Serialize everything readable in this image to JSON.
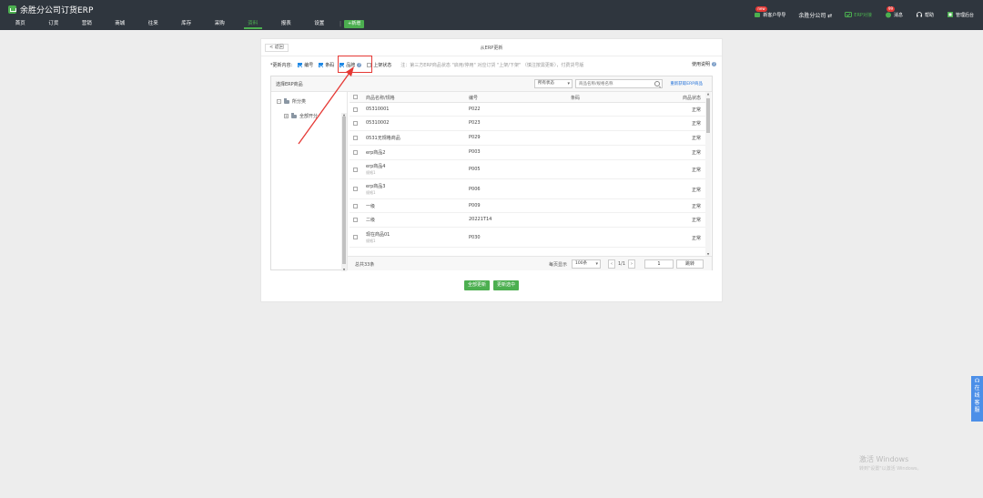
{
  "app": {
    "title": "余胜分公司订货ERP"
  },
  "nav": {
    "items": [
      "首页",
      "订货",
      "营销",
      "商城",
      "往来",
      "库存",
      "采购",
      "资料",
      "报表",
      "设置"
    ],
    "active_index": 7,
    "separator": "|",
    "new_label": "+新增"
  },
  "top_right": {
    "new_guide": {
      "badge": "new",
      "label": "新客户导导"
    },
    "company": "余胜分公司 ⇄",
    "erp_link": "ERP对接",
    "messages": {
      "badge": "99",
      "label": "消息"
    },
    "help": "帮助",
    "admin": "管理后台"
  },
  "card": {
    "back": "< 返回",
    "title": "从ERP更新",
    "options": {
      "label": "*更新内容:",
      "items": [
        {
          "label": "编号",
          "checked": true
        },
        {
          "label": "条码",
          "checked": true
        },
        {
          "label": "品牌",
          "checked": true
        },
        {
          "label": "上架状态",
          "checked": false
        }
      ],
      "note": "注：第三方ERP商品状态 \"启用/停用\" 对应订货 \"上架/下架\" （慎注按需更新），付费货号版"
    },
    "help_link": "使用说明",
    "panel": {
      "title": "选择ERP商品",
      "status_select": "所有状态",
      "search_placeholder": "商品名称/规格名称",
      "refetch_link": "重新获取ERP商品",
      "tree": [
        {
          "label": "所分类",
          "toggle": "-"
        },
        {
          "label": "全部开分",
          "toggle": "+"
        }
      ],
      "columns": {
        "name": "商品名称/规格",
        "code": "编号",
        "barcode": "条码",
        "status": "商品状态"
      },
      "rows": [
        {
          "name": "05310001",
          "sub": "",
          "code": "P022",
          "barcode": "",
          "status": "正常"
        },
        {
          "name": "05310002",
          "sub": "",
          "code": "P023",
          "barcode": "",
          "status": "正常"
        },
        {
          "name": "0531无规格商品",
          "sub": "",
          "code": "P029",
          "barcode": "",
          "status": "正常"
        },
        {
          "name": "erp商品2",
          "sub": "",
          "code": "P003",
          "barcode": "",
          "status": "正常"
        },
        {
          "name": "erp商品4",
          "sub": "规格1",
          "code": "P005",
          "barcode": "",
          "status": "正常"
        },
        {
          "name": "erp商品3",
          "sub": "规格1",
          "code": "P006",
          "barcode": "",
          "status": "正常"
        },
        {
          "name": "一级",
          "sub": "",
          "code": "P009",
          "barcode": "",
          "status": "正常"
        },
        {
          "name": "二级",
          "sub": "",
          "code": "20221T14",
          "barcode": "",
          "status": "正常"
        },
        {
          "name": "现在商品01",
          "sub": "规格1",
          "code": "P030",
          "barcode": "",
          "status": "正常"
        }
      ],
      "footer": {
        "total": "总共33条",
        "per_page_label": "每页显示",
        "per_page": "100条",
        "prev": "‹",
        "page_info": "1/1",
        "next": "›",
        "page_input": "1",
        "go": "跳转"
      }
    },
    "actions": {
      "update_all": "全部更新",
      "update_selected": "更新选中"
    }
  },
  "chat": {
    "chars": [
      "在",
      "线",
      "客",
      "服"
    ]
  },
  "watermark": {
    "line1": "激活 Windows",
    "line2": "转到\"设置\"以激活 Windows。"
  },
  "colors": {
    "topbar": "#2f363e",
    "accent": "#4caf50",
    "link": "#1e6fd9",
    "highlight": "#e53935",
    "chat": "#4c8fe8"
  }
}
